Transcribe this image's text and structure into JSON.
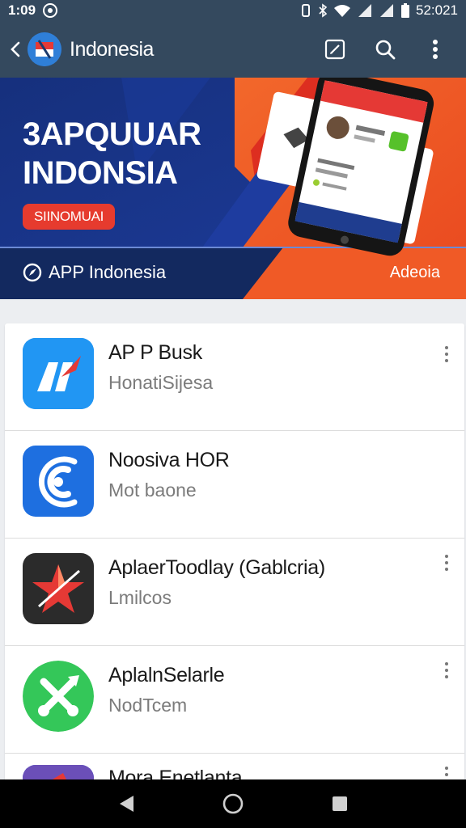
{
  "status_bar": {
    "time": "1:09",
    "clock_right": "52:021",
    "icons": [
      "whatsapp-icon",
      "vibrate-icon",
      "bluetooth-icon",
      "wifi-icon",
      "signal-icon",
      "signal-icon",
      "battery-icon"
    ]
  },
  "app_bar": {
    "title": "Indonesia",
    "actions": [
      "edit-icon",
      "search-icon",
      "more-vert-icon"
    ]
  },
  "banner": {
    "headline_line1": "3APQUUAR",
    "headline_line2": "INDONSIA",
    "pill_label": "SIINOMUAI",
    "brand": "APP Indonesia",
    "right_label": "Adeoia"
  },
  "apps": [
    {
      "title": "AP P Busk",
      "subtitle": "HonatiSijesa",
      "icon": "chart-icon",
      "icon_color": "#1e88e5"
    },
    {
      "title": "Noosiva HOR",
      "subtitle": "Mot baone",
      "icon": "wifi-icon",
      "icon_color": "#1e6fe0"
    },
    {
      "title": "AplaerToodlay (Gablcria)",
      "subtitle": "Lmilcos",
      "icon": "star-icon",
      "icon_color": "#2b2b2b"
    },
    {
      "title": "AplalnSelarle",
      "subtitle": "NodTcem",
      "icon": "tools-icon",
      "icon_color": "#34c759"
    },
    {
      "title": "Mora Enetlanta",
      "subtitle": "",
      "icon": "app-icon",
      "icon_color": "#2563eb"
    }
  ],
  "colors": {
    "app_bar": "#34495e",
    "banner_blue": "#1a2f7a",
    "banner_orange": "#f1562a",
    "pill_red": "#e63b2e"
  },
  "nav_bar": [
    "back-triangle-icon",
    "home-circle-icon",
    "recents-square-icon"
  ]
}
